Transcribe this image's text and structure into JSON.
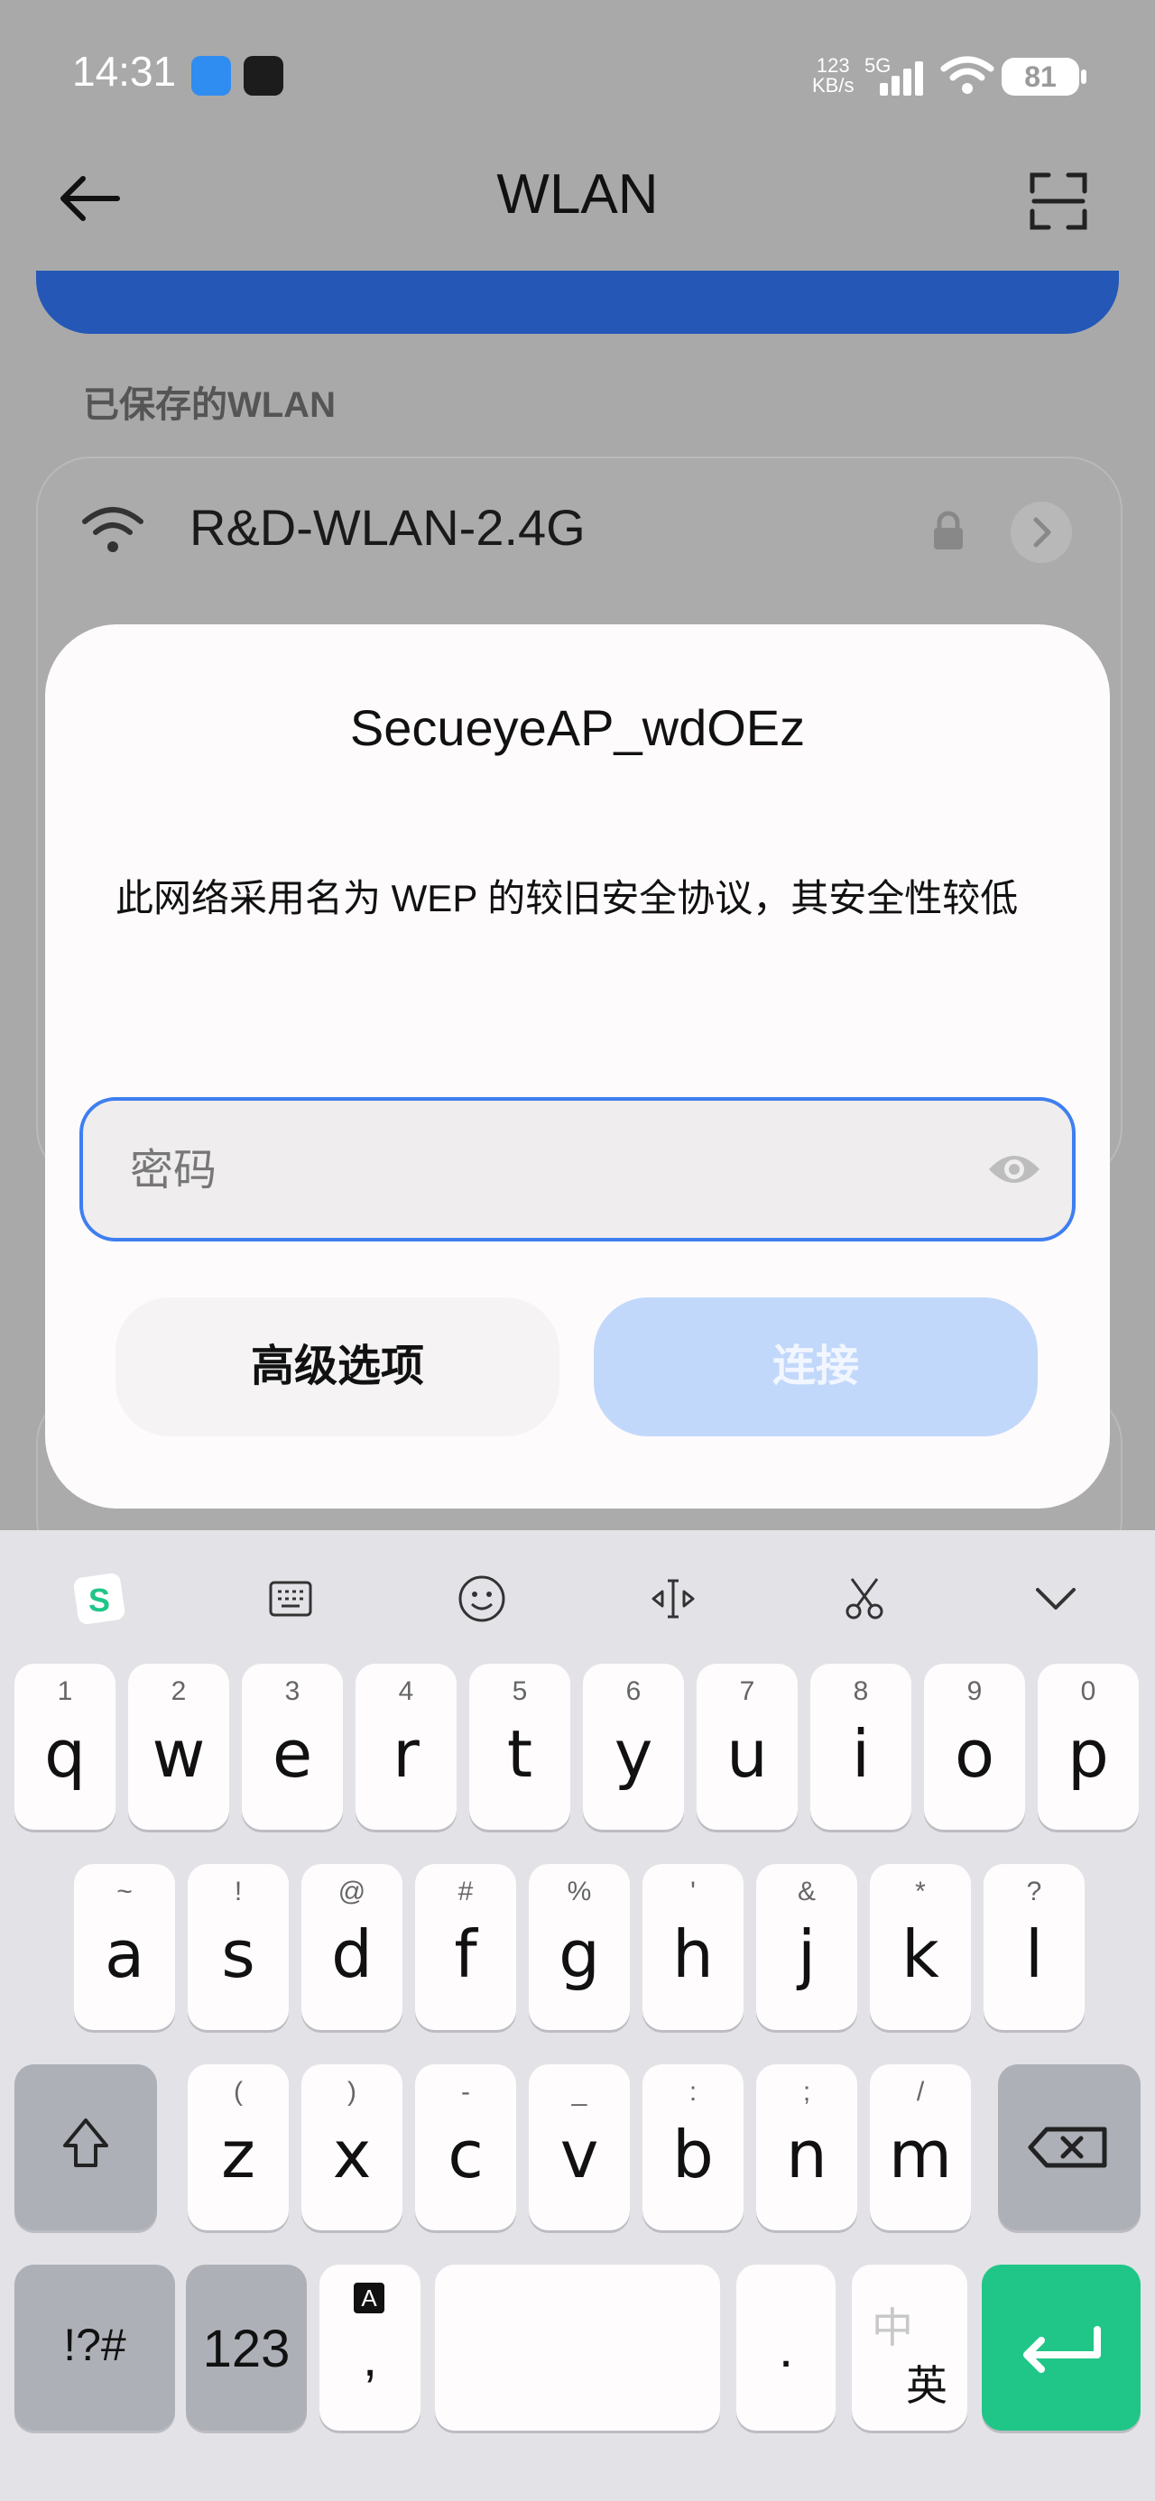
{
  "status_bar": {
    "time": "14:31",
    "net_speed_value": "123",
    "net_speed_unit": "KB/s",
    "network_type": "5G",
    "battery": "81"
  },
  "header": {
    "title": "WLAN"
  },
  "section_label": "已保存的WLAN",
  "saved_network": {
    "ssid": "R&D-WLAN-2.4G"
  },
  "dialog": {
    "title": "SecueyeAP_wdOEz",
    "message": "此网络采用名为 WEP 的较旧安全协议，其安全性较低",
    "password_placeholder": "密码",
    "advanced_button": "高级选项",
    "connect_button": "连接"
  },
  "keyboard": {
    "row1": [
      {
        "hint": "1",
        "char": "q"
      },
      {
        "hint": "2",
        "char": "w"
      },
      {
        "hint": "3",
        "char": "e"
      },
      {
        "hint": "4",
        "char": "r"
      },
      {
        "hint": "5",
        "char": "t"
      },
      {
        "hint": "6",
        "char": "y"
      },
      {
        "hint": "7",
        "char": "u"
      },
      {
        "hint": "8",
        "char": "i"
      },
      {
        "hint": "9",
        "char": "o"
      },
      {
        "hint": "0",
        "char": "p"
      }
    ],
    "row2": [
      {
        "hint": "~",
        "char": "a"
      },
      {
        "hint": "!",
        "char": "s"
      },
      {
        "hint": "@",
        "char": "d"
      },
      {
        "hint": "#",
        "char": "f"
      },
      {
        "hint": "%",
        "char": "g"
      },
      {
        "hint": "'",
        "char": "h"
      },
      {
        "hint": "&",
        "char": "j"
      },
      {
        "hint": "*",
        "char": "k"
      },
      {
        "hint": "?",
        "char": "l"
      }
    ],
    "row3": [
      {
        "hint": "(",
        "char": "z"
      },
      {
        "hint": ")",
        "char": "x"
      },
      {
        "hint": "-",
        "char": "c"
      },
      {
        "hint": "_",
        "char": "v"
      },
      {
        "hint": ":",
        "char": "b"
      },
      {
        "hint": ";",
        "char": "n"
      },
      {
        "hint": "/",
        "char": "m"
      }
    ],
    "symbols_label": "!?#",
    "numbers_label": "123",
    "comma_hint": "A",
    "comma_label": ",",
    "period_label": ".",
    "lang_top": "中",
    "lang_bottom": "英",
    "enter_color": "#20c688"
  }
}
